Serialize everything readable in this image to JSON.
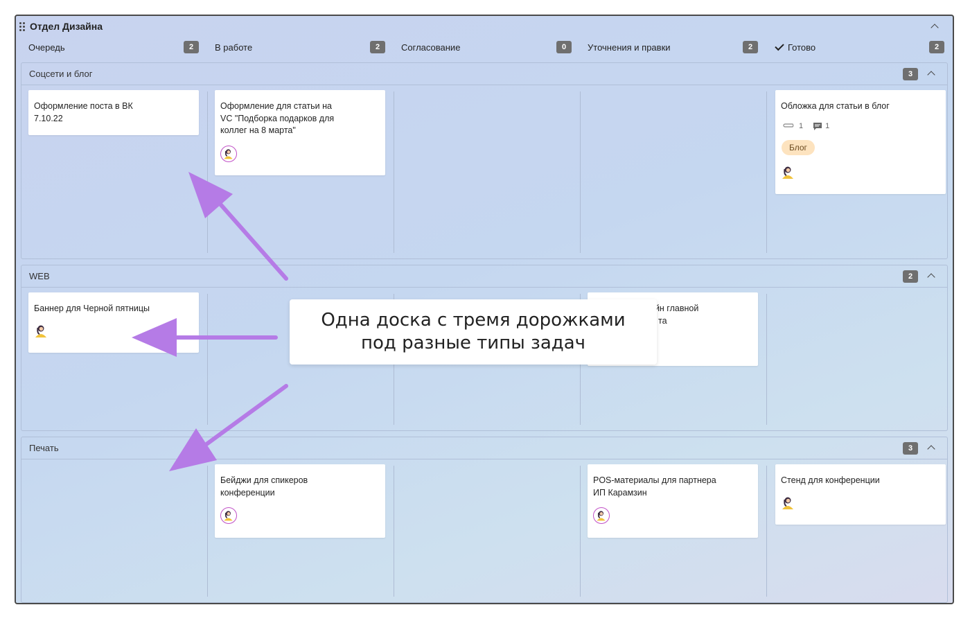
{
  "board": {
    "title": "Отдел Дизайна"
  },
  "columns": [
    {
      "label": "Очередь",
      "count": "2"
    },
    {
      "label": "В работе",
      "count": "2"
    },
    {
      "label": "Согласование",
      "count": "0"
    },
    {
      "label": "Уточнения и правки",
      "count": "2"
    },
    {
      "label": "Готово",
      "count": "2"
    }
  ],
  "lanes": [
    {
      "title": "Соцсети и блог",
      "count": "3"
    },
    {
      "title": "WEB",
      "count": "2"
    },
    {
      "title": "Печать",
      "count": "3"
    }
  ],
  "cards": {
    "social_queue": {
      "line1": "Оформление поста в ВК",
      "line2": "7.10.22"
    },
    "social_inwork": {
      "line1": "Оформление для статьи на",
      "line2": "VC \"Подборка подарков для",
      "line3": "коллег на 8 марта\""
    },
    "social_done": {
      "title": "Обложка для статьи в блог",
      "attachments": "1",
      "comments": "1",
      "tag": "Блог"
    },
    "web_queue": {
      "title": "Баннер для Черной пятницы"
    },
    "web_fixes": {
      "line1": "айн главной",
      "line2": "та"
    },
    "print_inwork": {
      "line1": "Бейджи для спикеров",
      "line2": "конференции"
    },
    "print_fixes": {
      "line1": "POS-материалы для партнера",
      "line2": "ИП Карамзин"
    },
    "print_done": {
      "title": "Стенд для конференции"
    }
  },
  "callout": {
    "line1": "Одна доска с тремя дорожками",
    "line2": "под разные типы задач"
  },
  "colors": {
    "arrow": "#b57be6",
    "avatar_ring": "#c04fc6",
    "tag_bg": "#fde3bf",
    "count_bg": "#6f6f6f"
  },
  "icons": [
    "drag-handle-icon",
    "chevron-up-icon",
    "check-icon",
    "paperclip-icon",
    "comment-icon",
    "avatar-icon"
  ]
}
